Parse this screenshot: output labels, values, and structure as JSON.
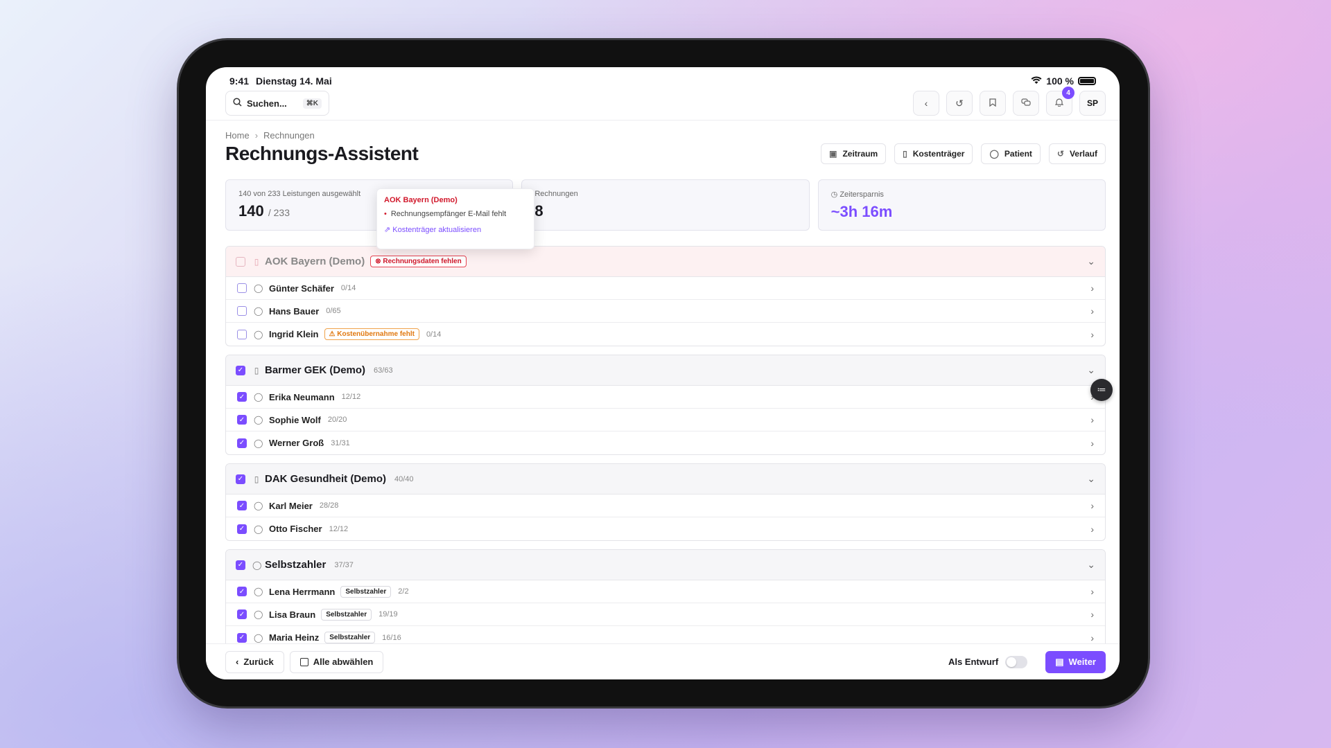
{
  "status": {
    "time": "9:41",
    "date": "Dienstag 14. Mai",
    "battery": "100 %"
  },
  "topbar": {
    "search_label": "Suchen...",
    "search_shortcut": "⌘K",
    "notification_count": "4",
    "avatar_initials": "SP"
  },
  "breadcrumb": {
    "home": "Home",
    "current": "Rechnungen"
  },
  "page_title": "Rechnungs-Assistent",
  "actions": [
    "Zeitraum",
    "Kostenträger",
    "Patient",
    "Verlauf"
  ],
  "stats": {
    "selected_label": "140 von 233 Leistungen ausgewählt",
    "selected_value": "140",
    "selected_total": "/ 233",
    "invoices_label": "Rechnungen",
    "invoices_value": "8",
    "savings_label": "Zeitersparnis",
    "savings_value": "~3h 16m"
  },
  "popover": {
    "title": "AOK Bayern (Demo)",
    "item": "Rechnungsempfänger E-Mail fehlt",
    "link": "Kostenträger aktualisieren"
  },
  "groups": [
    {
      "name": "AOK Bayern (Demo)",
      "count": "",
      "error_tag": "Rechnungsdaten fehlen",
      "rows": [
        {
          "name": "Günter Schäfer",
          "count": "0/14",
          "tag": ""
        },
        {
          "name": "Hans Bauer",
          "count": "0/65",
          "tag": ""
        },
        {
          "name": "Ingrid Klein",
          "count": "0/14",
          "tag": "Kostenübernahme fehlt"
        }
      ]
    },
    {
      "name": "Barmer GEK (Demo)",
      "count": "63/63",
      "rows": [
        {
          "name": "Erika Neumann",
          "count": "12/12"
        },
        {
          "name": "Sophie Wolf",
          "count": "20/20"
        },
        {
          "name": "Werner Groß",
          "count": "31/31"
        }
      ]
    },
    {
      "name": "DAK Gesundheit (Demo)",
      "count": "40/40",
      "rows": [
        {
          "name": "Karl Meier",
          "count": "28/28"
        },
        {
          "name": "Otto Fischer",
          "count": "12/12"
        }
      ]
    },
    {
      "name": "Selbstzahler",
      "count": "37/37",
      "rows": [
        {
          "name": "Lena Herrmann",
          "count": "2/2",
          "tag": "Selbstzahler"
        },
        {
          "name": "Lisa Braun",
          "count": "19/19",
          "tag": "Selbstzahler"
        },
        {
          "name": "Maria Heinz",
          "count": "16/16",
          "tag": "Selbstzahler"
        }
      ]
    }
  ],
  "footer": {
    "back_label": "Zurück",
    "deselect_label": "Alle abwählen",
    "draft_label": "Als Entwurf",
    "next_label": "Weiter"
  },
  "colors": {
    "accent": "#7b4dff",
    "error": "#d1182b",
    "warning": "#e07810"
  }
}
